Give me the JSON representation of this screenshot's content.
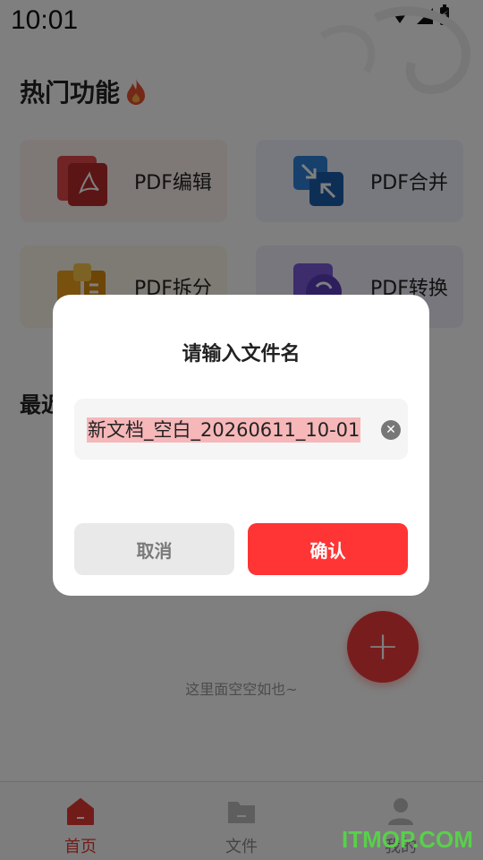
{
  "status_bar": {
    "time": "10:01"
  },
  "hot_features": {
    "title": "热门功能",
    "items": [
      {
        "label": "PDF编辑",
        "icon": "pdf-edit-icon"
      },
      {
        "label": "PDF合并",
        "icon": "pdf-merge-icon"
      },
      {
        "label": "PDF拆分",
        "icon": "pdf-split-icon"
      },
      {
        "label": "PDF转换",
        "icon": "pdf-convert-icon"
      }
    ]
  },
  "recent": {
    "title": "最近"
  },
  "empty_state": {
    "text": "这里面空空如也~"
  },
  "fab": {
    "label": "+"
  },
  "bottom_nav": {
    "items": [
      {
        "label": "首页",
        "icon": "home-icon",
        "active": true
      },
      {
        "label": "文件",
        "icon": "folder-icon",
        "active": false
      },
      {
        "label": "我的",
        "icon": "user-icon",
        "active": false
      }
    ]
  },
  "watermark": "ITMOP.COM",
  "dialog": {
    "title": "请输入文件名",
    "input_value": "新文档_空白_20260611_10-01",
    "cancel_label": "取消",
    "confirm_label": "确认"
  },
  "colors": {
    "accent": "#ff3434",
    "selection_highlight": "#f6b7b9",
    "active_nav": "#e53935"
  }
}
